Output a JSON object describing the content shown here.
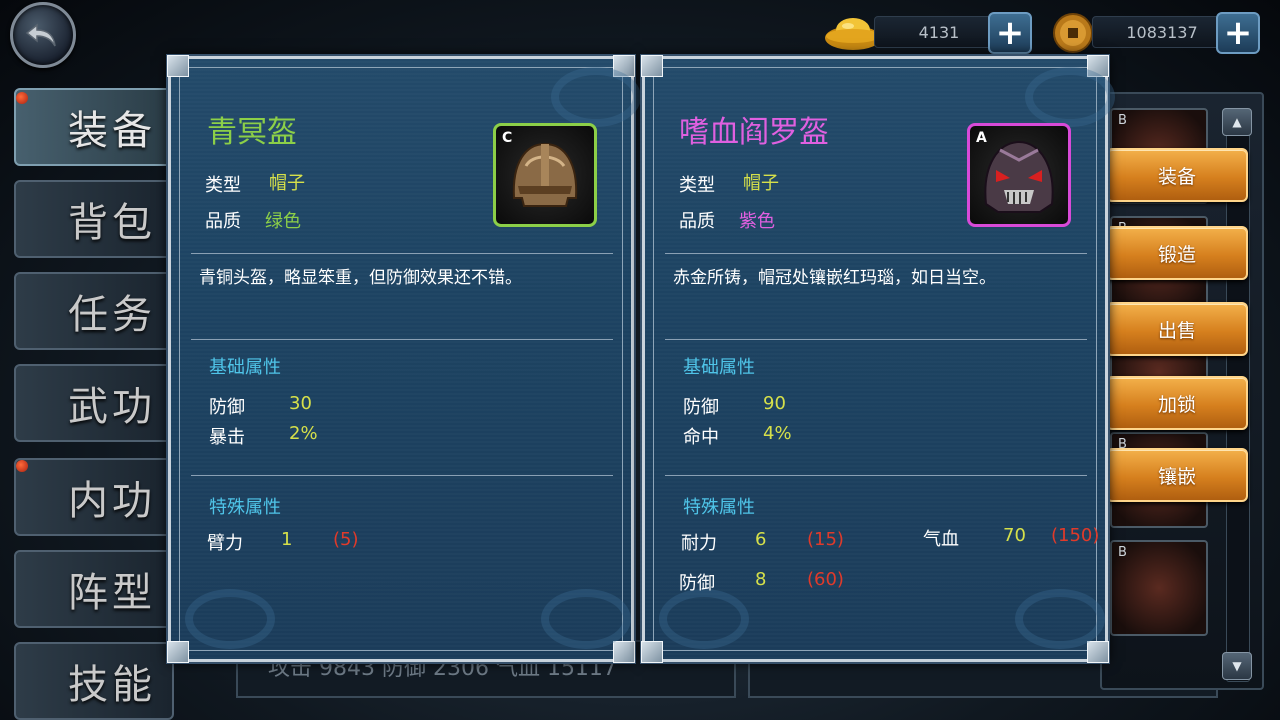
{
  "currency": {
    "gold": {
      "icon": "gold-ingot-icon",
      "value": "4131"
    },
    "coin": {
      "icon": "copper-coin-icon",
      "value": "1083137"
    }
  },
  "side_tabs": [
    "装备",
    "背包",
    "任务",
    "武功",
    "内功",
    "阵型",
    "技能"
  ],
  "bottom_stats": "攻击 9843  防御 2306  气血 15117",
  "bag_grade": "B",
  "actions": [
    "装备",
    "锻造",
    "出售",
    "加锁",
    "镶嵌"
  ],
  "card_left": {
    "name": "青冥盔",
    "name_color": "#8ccf48",
    "grade": "C",
    "type_label": "类型",
    "type_value": "帽子",
    "quality_label": "品质",
    "quality_value": "绿色",
    "description": "青铜头盔，略显笨重，但防御效果还不错。",
    "base_title": "基础属性",
    "base_attrs": [
      {
        "name": "防御",
        "value": "30"
      },
      {
        "name": "暴击",
        "value": "2%"
      }
    ],
    "special_title": "特殊属性",
    "special_attrs": [
      {
        "name": "臂力",
        "value": "1",
        "max": "(5)"
      }
    ]
  },
  "card_right": {
    "name": "嗜血阎罗盔",
    "name_color": "#e060e0",
    "grade": "A",
    "type_label": "类型",
    "type_value": "帽子",
    "quality_label": "品质",
    "quality_value": "紫色",
    "description": "赤金所铸，帽冠处镶嵌红玛瑙，如日当空。",
    "base_title": "基础属性",
    "base_attrs": [
      {
        "name": "防御",
        "value": "90"
      },
      {
        "name": "命中",
        "value": "4%"
      }
    ],
    "special_title": "特殊属性",
    "special_attrs": [
      {
        "name": "耐力",
        "value": "6",
        "max": "(15)"
      },
      {
        "name": "防御",
        "value": "8",
        "max": "(60)"
      },
      {
        "name": "气血",
        "value": "70",
        "max": "(150)"
      }
    ]
  }
}
